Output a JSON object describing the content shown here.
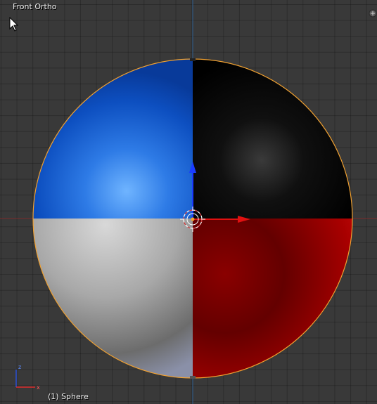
{
  "viewport": {
    "view_name": "Front Ortho",
    "object_info": "(1) Sphere"
  },
  "colors": {
    "background": "#393939",
    "x_axis": "#a02020",
    "z_axis": "#2a5aa0",
    "selection_outline": "#f0a030",
    "quadrant_top_left": "#1a5fd0",
    "quadrant_top_right": "#000000",
    "quadrant_bottom_left": "#b0b0b0",
    "quadrant_bottom_right": "#b00000"
  },
  "icons": {
    "cursor": "mouse-pointer-icon",
    "corner": "viewport-corner-widget-icon",
    "pivot": "3d-cursor-icon",
    "axes": "view-axis-gizmo-icon"
  }
}
